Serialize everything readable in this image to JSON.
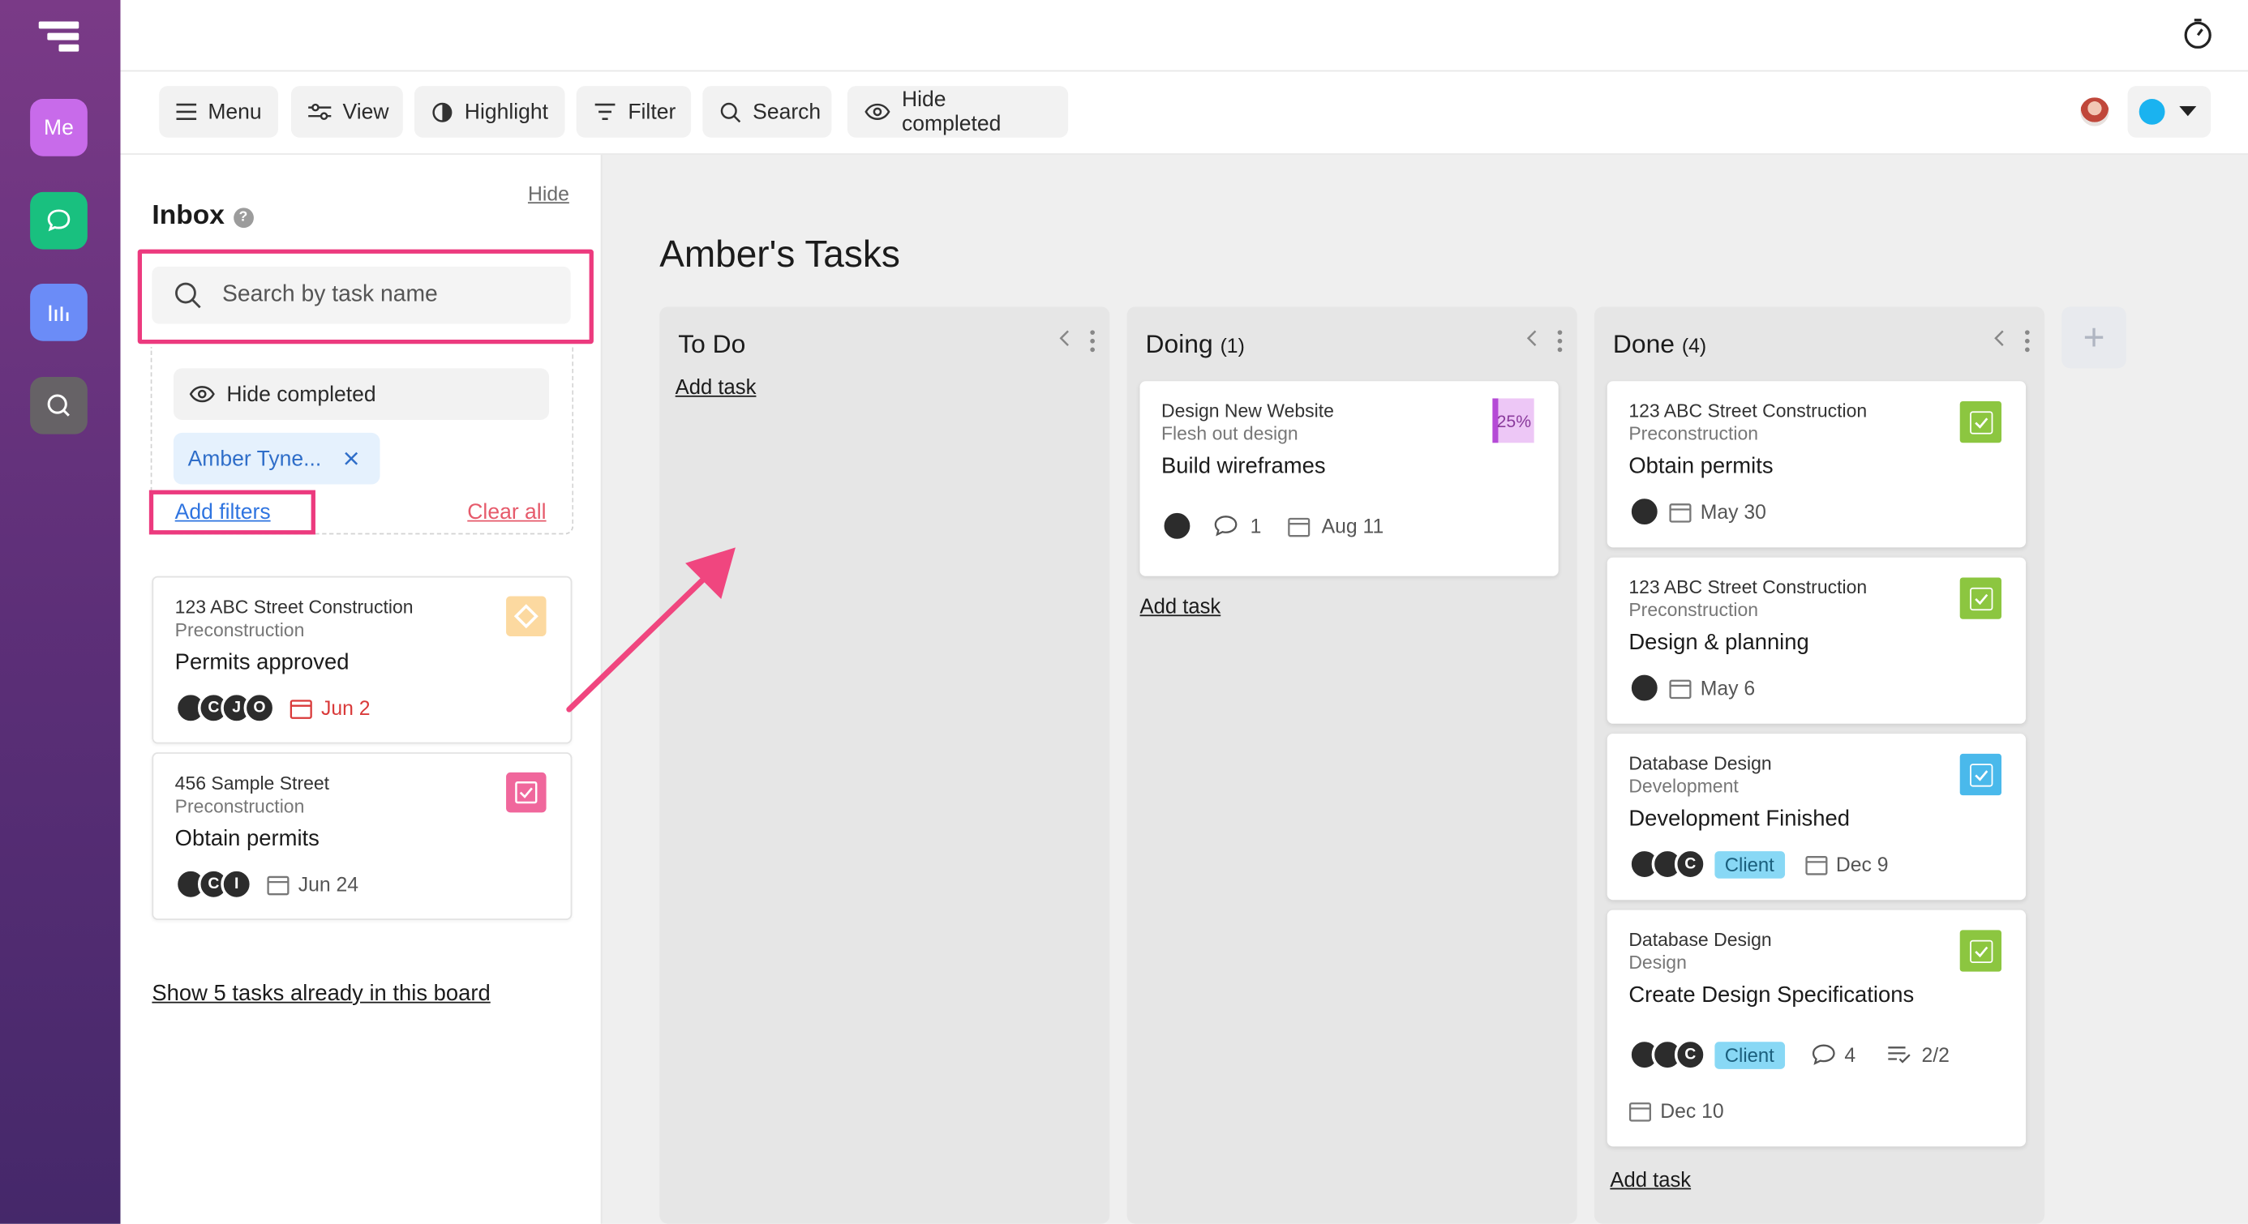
{
  "rail": {
    "me_label": "Me",
    "colors": {
      "me": "#c86bea",
      "chat": "#19c07f",
      "analytics": "#6b8cf7",
      "search": "#666266"
    }
  },
  "toolbar": {
    "menu": "Menu",
    "view": "View",
    "highlight": "Highlight",
    "filter": "Filter",
    "search": "Search",
    "hide_completed": "Hide completed"
  },
  "inbox": {
    "title": "Inbox",
    "help": "?",
    "hide": "Hide",
    "search_placeholder": "Search by task name",
    "hide_completed": "Hide completed",
    "assignee_chip": "Amber Tyne...",
    "add_filters": "Add filters",
    "clear_all": "Clear all",
    "cards": [
      {
        "project": "123 ABC Street Construction",
        "phase": "Preconstruction",
        "name": "Permits approved",
        "avatars": [
          "",
          "C",
          "J",
          "O"
        ],
        "date": "Jun 2",
        "date_color": "#d93a3a",
        "status": "milestone"
      },
      {
        "project": "456 Sample Street",
        "phase": "Preconstruction",
        "name": "Obtain permits",
        "avatars": [
          "",
          "C",
          "I"
        ],
        "date": "Jun 24",
        "date_color": "#555555",
        "status": "done-pink"
      }
    ],
    "show_link": "Show 5 tasks already in this board"
  },
  "board": {
    "title": "Amber's Tasks",
    "columns": [
      {
        "name": "To Do",
        "count": "",
        "add_task": "Add task"
      },
      {
        "name": "Doing",
        "count": "(1)",
        "add_task": "Add task",
        "cards": [
          {
            "project": "Design New Website",
            "phase": "Flesh out design",
            "name": "Build wireframes",
            "progress": "25%",
            "comments": "1",
            "date": "Aug 11"
          }
        ]
      },
      {
        "name": "Done",
        "count": "(4)",
        "add_task": "Add task",
        "cards": [
          {
            "project": "123 ABC Street Construction",
            "phase": "Preconstruction",
            "name": "Obtain permits",
            "date": "May 30"
          },
          {
            "project": "123 ABC Street Construction",
            "phase": "Preconstruction",
            "name": "Design & planning",
            "date": "May 6"
          },
          {
            "project": "Database Design",
            "phase": "Development",
            "name": "Development Finished",
            "tag": "Client",
            "avatar_letter": "C",
            "date": "Dec 9"
          },
          {
            "project": "Database Design",
            "phase": "Design",
            "name": "Create Design Specifications",
            "tag": "Client",
            "avatar_letter": "C",
            "comments": "4",
            "checklist": "2/2",
            "date": "Dec 10"
          }
        ]
      }
    ]
  }
}
